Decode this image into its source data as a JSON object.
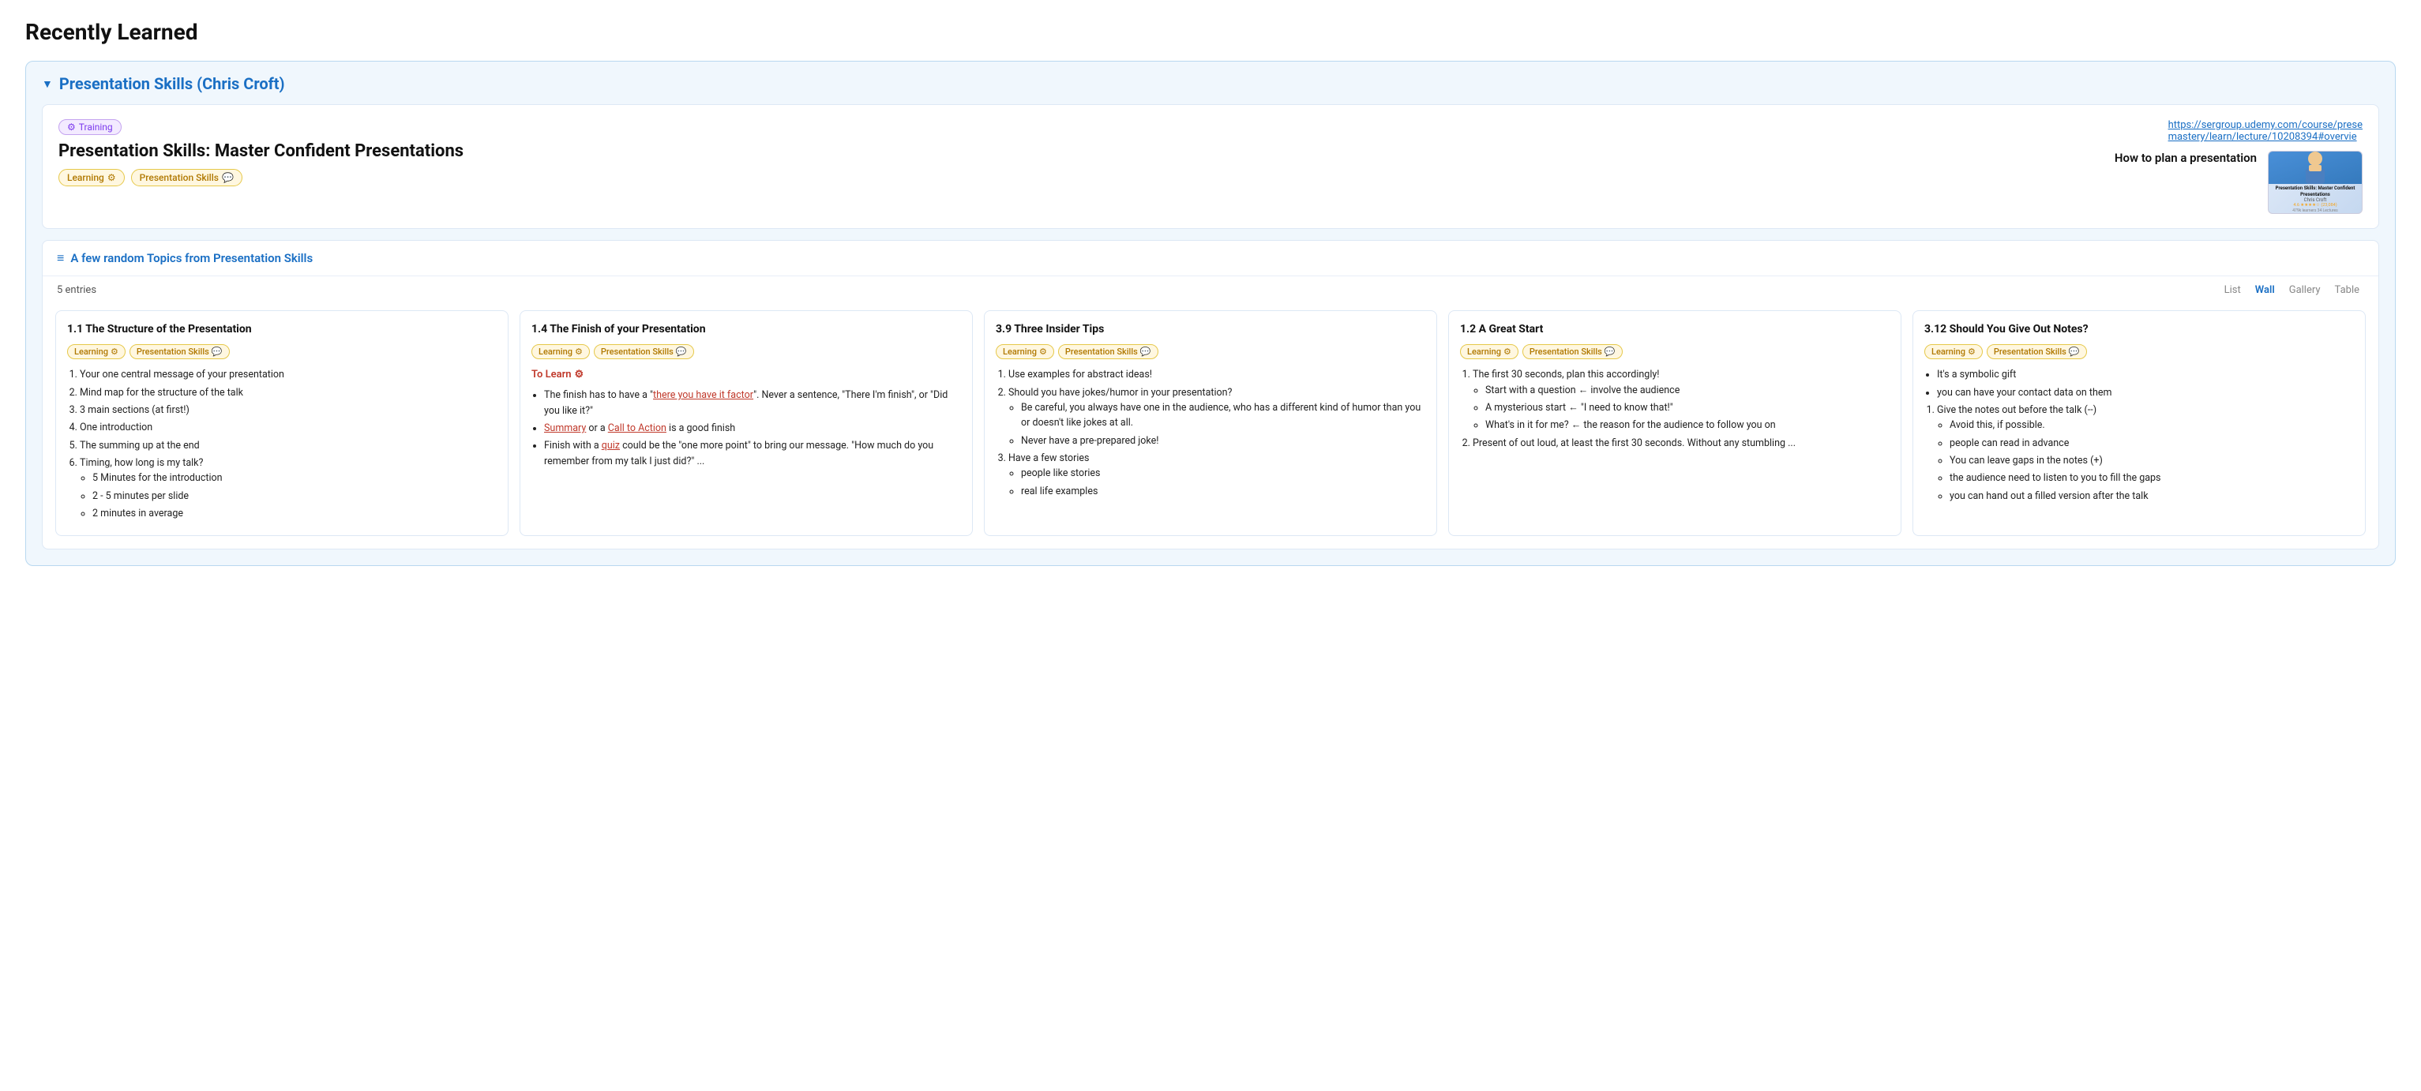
{
  "page": {
    "title": "Recently Learned"
  },
  "section": {
    "title": "Presentation Skills (Chris Croft)",
    "toggle_symbol": "▼"
  },
  "course_card": {
    "badge_label": "Training",
    "badge_icon": "⚙",
    "title": "Presentation Skills: Master Confident Presentations",
    "tag_learning": "Learning",
    "tag_learning_icon": "⚙",
    "tag_presentation": "Presentation Skills",
    "tag_presentation_icon": "💬",
    "link": "https://sergroup.udemy.com/course/presentation-mastery/learn/lecture/10208394#overview",
    "link_display": "https://sergroup.udemy.com/course/prese\nmastery/learn/lecture/10208394#overvie",
    "how_to_plan": "How to plan a presentation",
    "thumbnail_title": "Presentation Skills: Master Confident Presentations",
    "thumbnail_author": "Chris Croft",
    "thumbnail_rating": "4.6 ★★★★☆ (23,084)",
    "thumbnail_learners": "479k learners   34 Lectures"
  },
  "topics": {
    "header_icon": "≡",
    "title": "A few random Topics from Presentation Skills",
    "entries_count": "5 entries",
    "view_list": "List",
    "view_wall": "Wall",
    "view_gallery": "Gallery",
    "view_table": "Table",
    "active_view": "Wall"
  },
  "cards": [
    {
      "id": "card1",
      "title": "1.1 The Structure of the Presentation",
      "tag_learning": "Learning",
      "tag_presentation": "Presentation Skills",
      "content_type": "ordered_list",
      "items": [
        {
          "text": "Your one central message of your presentation",
          "sub": []
        },
        {
          "text": "Mind map for the structure of the talk",
          "sub": []
        },
        {
          "text": "3 main sections (at first!)",
          "sub": []
        },
        {
          "text": "One introduction",
          "sub": []
        },
        {
          "text": "The summing up at the end",
          "sub": []
        },
        {
          "text": "Timing, how long is my talk?",
          "sub": [
            "5 Minutes for the introduction",
            "2 - 5 minutes per slide",
            "2 minutes in average"
          ]
        }
      ]
    },
    {
      "id": "card2",
      "title": "1.4 The Finish of your Presentation",
      "tag_learning": "Learning",
      "tag_presentation": "Presentation Skills",
      "content_type": "mixed",
      "to_learn_label": "To Learn",
      "items": [
        {
          "text": "The finish has to have a \"there you have it factor\". Never a sentence, \"There I'm finish\", or \"Did you like it?\"",
          "links": [
            "there you have it factor"
          ]
        },
        {
          "text": "Summary or a Call to Action is a good finish",
          "links": [
            "Summary",
            "Call to Action"
          ]
        },
        {
          "text": "Finish with a quiz could be the \"one more point\" to bring our message. \"How much do you remember from my talk I just did?\" ...",
          "links": [
            "quiz"
          ]
        }
      ]
    },
    {
      "id": "card3",
      "title": "3.9 Three Insider Tips",
      "tag_learning": "Learning",
      "tag_presentation": "Presentation Skills",
      "content_type": "ordered_list_mixed",
      "items": [
        {
          "text": "Use examples for abstract ideas!",
          "sub": []
        },
        {
          "text": "Should you have jokes/humor in your presentation?",
          "sub": [
            "Be careful, you always have one in the audience, who has a different kind of humor than you or doesn't like jokes at all.",
            "Never have a pre-prepared joke!"
          ]
        },
        {
          "text": "Have a few stories",
          "sub": [
            "people like stories",
            "real life examples"
          ]
        }
      ]
    },
    {
      "id": "card4",
      "title": "1.2 A Great Start",
      "tag_learning": "Learning",
      "tag_presentation": "Presentation Skills",
      "content_type": "ordered_list_mixed",
      "items": [
        {
          "text": "The first 30 seconds, plan this accordingly!",
          "sub": [
            "Start with a question ← involve the audience",
            "A mysterious start ← \"I need to know that!\"",
            "What's in it for me? ← the reason for the audience to follow you on"
          ]
        },
        {
          "text": "Present of out loud, at least the first 30 seconds. Without any stumbling ...",
          "sub": []
        }
      ]
    },
    {
      "id": "card5",
      "title": "3.12 Should You Give Out Notes?",
      "tag_learning": "Learning",
      "tag_presentation": "Presentation Skills",
      "content_type": "mixed_bullet_ordered",
      "items": [
        {
          "type": "bullet",
          "text": "It's a symbolic gift"
        },
        {
          "type": "bullet",
          "text": "you can have your contact data on them"
        },
        {
          "type": "ordered",
          "num": 1,
          "text": "Give the notes out before the talk (--)",
          "sub": [
            "Avoid this, if possible.",
            "people can read in advance",
            "You can leave gaps in the notes (+)",
            "the audience need to listen to you to fill the gaps",
            "you can hand out a filled version after the talk"
          ]
        }
      ]
    }
  ]
}
